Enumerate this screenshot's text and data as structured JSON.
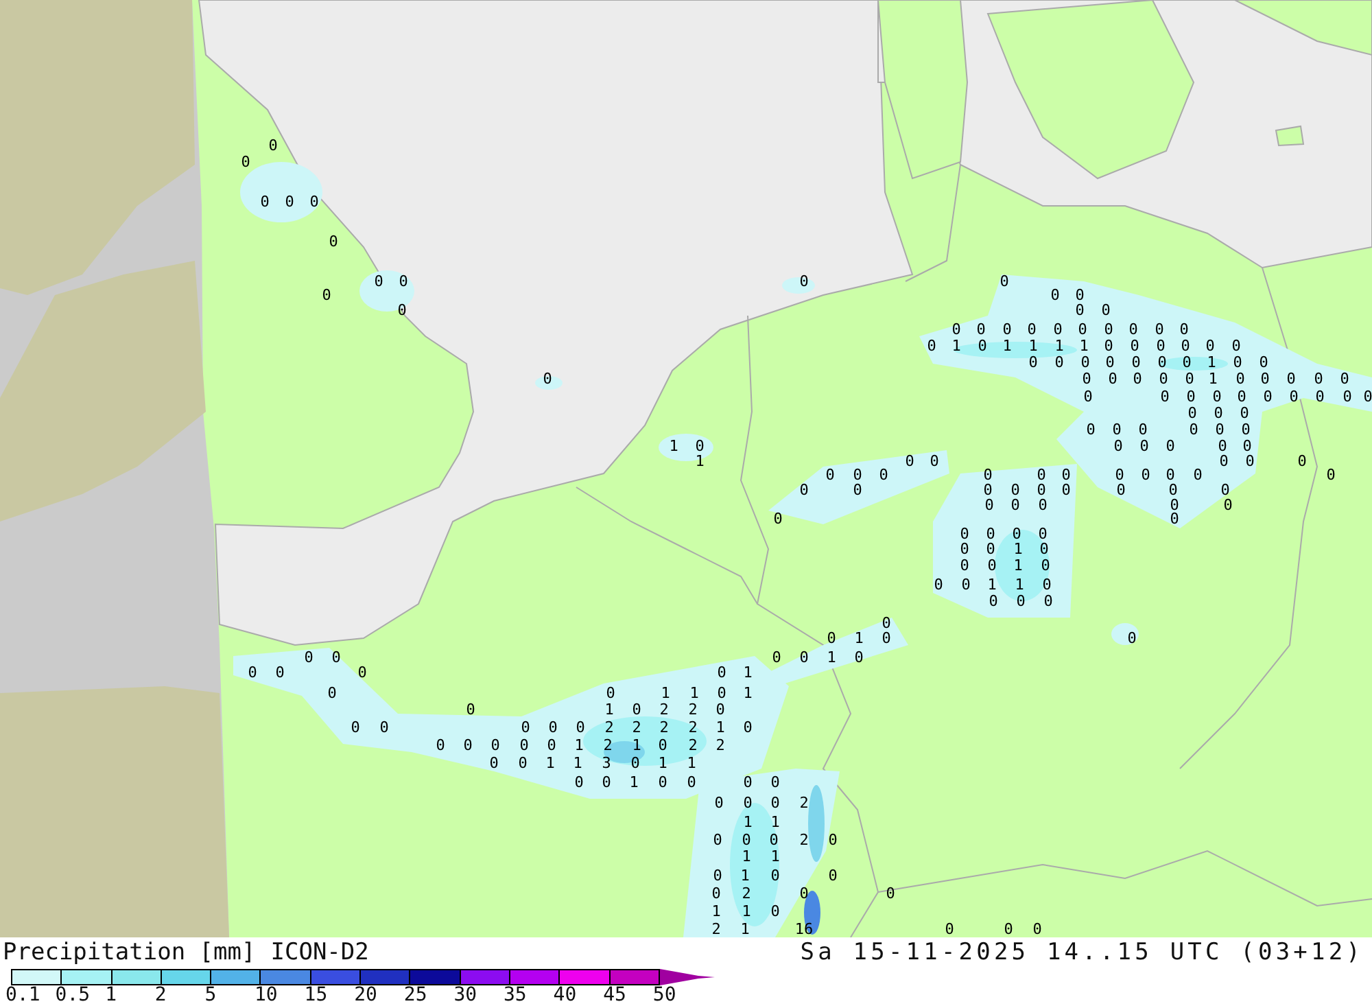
{
  "map": {
    "value_labels": [
      "0",
      "0",
      "0",
      "0",
      "0",
      "0",
      "0",
      "0",
      "0",
      "0",
      "0",
      "0",
      "0",
      "0",
      "0",
      "0",
      "0",
      "0",
      "0",
      "0",
      "0",
      "0",
      "0",
      "0",
      "0",
      "0",
      "0",
      "1",
      "0",
      "1",
      "1",
      "1",
      "1",
      "0",
      "0",
      "0",
      "0",
      "0",
      "0",
      "0",
      "0",
      "0",
      "0",
      "0",
      "0",
      "0",
      "1",
      "0",
      "0",
      "0",
      "0",
      "0",
      "0",
      "0",
      "0",
      "1",
      "0",
      "0",
      "0",
      "0",
      "0",
      "0",
      "0",
      "0",
      "0",
      "0",
      "0",
      "0",
      "0",
      "0",
      "0",
      "0",
      "0",
      "0",
      "0",
      "0",
      "0",
      "0",
      "0",
      "0",
      "1",
      "0",
      "0",
      "0",
      "0",
      "0",
      "0",
      "1",
      "0",
      "0",
      "0",
      "0",
      "0",
      "0",
      "0",
      "0",
      "0",
      "0",
      "0",
      "0",
      "0",
      "0",
      "0",
      "0",
      "0",
      "0",
      "0",
      "0",
      "0",
      "0",
      "0",
      "0",
      "0",
      "0",
      "0",
      "0",
      "0",
      "0",
      "0",
      "0",
      "0",
      "0",
      "0",
      "0",
      "0",
      "0",
      "1",
      "0",
      "0",
      "0",
      "1",
      "0",
      "0",
      "0",
      "1",
      "1",
      "0",
      "0",
      "0",
      "0",
      "0",
      "0",
      "1",
      "0",
      "0",
      "0",
      "0",
      "0",
      "0",
      "1",
      "0",
      "0",
      "0",
      "0",
      "0",
      "1",
      "0",
      "0",
      "1",
      "1",
      "0",
      "1",
      "0",
      "1",
      "0",
      "2",
      "2",
      "0",
      "0",
      "0",
      "0",
      "0",
      "0",
      "2",
      "2",
      "2",
      "2",
      "1",
      "0",
      "0",
      "0",
      "0",
      "0",
      "0",
      "1",
      "2",
      "1",
      "0",
      "2",
      "2",
      "0",
      "0",
      "1",
      "1",
      "3",
      "0",
      "1",
      "1",
      "0",
      "0",
      "1",
      "0",
      "0",
      "0",
      "0",
      "0",
      "0",
      "0",
      "2",
      "1",
      "1",
      "0",
      "0",
      "0",
      "2",
      "0",
      "1",
      "1",
      "0",
      "1",
      "0",
      "0",
      "0",
      "2",
      "0",
      "0",
      "1",
      "1",
      "0",
      "2",
      "1",
      "16",
      "0",
      "0",
      "0"
    ]
  },
  "legend": {
    "title": "Precipitation [mm]",
    "model": "ICON-D2",
    "valid_time": "Sa 15-11-2025 14..15 UTC (03+12)",
    "bins": [
      {
        "color": "#d2f8f8"
      },
      {
        "color": "#a6f2f4"
      },
      {
        "color": "#8ae8ec"
      },
      {
        "color": "#66d6ea"
      },
      {
        "color": "#52b2e8"
      },
      {
        "color": "#4a88e2"
      },
      {
        "color": "#3a4ee0"
      },
      {
        "color": "#2030c0"
      },
      {
        "color": "#0c0a9a"
      },
      {
        "color": "#8c0cf0"
      },
      {
        "color": "#b400f0"
      },
      {
        "color": "#ee00ee"
      },
      {
        "color": "#c400c0"
      }
    ],
    "extension": {
      "color": "#a000a0"
    },
    "ticks": [
      "0.1",
      "0.5",
      "1",
      "2",
      "5",
      "10",
      "15",
      "20",
      "25",
      "30",
      "35",
      "40",
      "45",
      "50"
    ]
  }
}
